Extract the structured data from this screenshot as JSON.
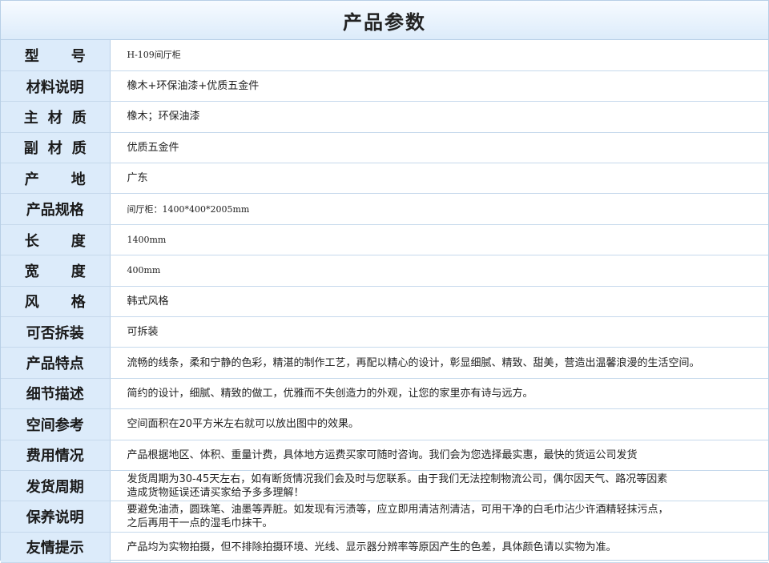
{
  "title": "产品参数",
  "rows": [
    {
      "label": "型号",
      "value": "H-109间厅柜"
    },
    {
      "label": "材料说明",
      "value": "橡木+环保油漆+优质五金件"
    },
    {
      "label": "主材质",
      "value": "橡木；环保油漆"
    },
    {
      "label": "副材质",
      "value": "优质五金件"
    },
    {
      "label": "产地",
      "value": "广东"
    },
    {
      "label": "产品规格",
      "value": "间厅柜：1400*400*2005mm"
    },
    {
      "label": "长度",
      "value": "1400mm"
    },
    {
      "label": "宽度",
      "value": "400mm"
    },
    {
      "label": "风格",
      "value": "韩式风格"
    },
    {
      "label": "可否拆装",
      "value": "可拆装"
    },
    {
      "label": "产品特点",
      "value": "流畅的线条，柔和宁静的色彩，精湛的制作工艺，再配以精心的设计，彰显细腻、精致、甜美，营造出温馨浪漫的生活空间。"
    },
    {
      "label": "细节描述",
      "value": "简约的设计，细腻、精致的做工，优雅而不失创造力的外观，让您的家里亦有诗与远方。"
    },
    {
      "label": "空间参考",
      "value": "空间面积在20平方米左右就可以放出图中的效果。"
    },
    {
      "label": "费用情况",
      "value": "产品根据地区、体积、重量计费，具体地方运费买家可随时咨询。我们会为您选择最实惠，最快的货运公司发货"
    },
    {
      "label": "发货周期",
      "value_lines": [
        "发货周期为30-45天左右，如有断货情况我们会及时与您联系。由于我们无法控制物流公司，偶尔因天气、路况等因素",
        "造成货物延误还请买家给予多多理解！"
      ]
    },
    {
      "label": "保养说明",
      "value_lines": [
        "要避免油渍，圆珠笔、油墨等弄脏。如发现有污渍等，应立即用清洁剂清洁，可用干净的白毛巾沾少许酒精轻抹污点，",
        "之后再用干一点的湿毛巾抹干。"
      ]
    },
    {
      "label": "友情提示",
      "value": "产品均为实物拍摄，但不排除拍摄环境、光线、显示器分辨率等原因产生的色差，具体颜色请以实物为准。"
    }
  ]
}
